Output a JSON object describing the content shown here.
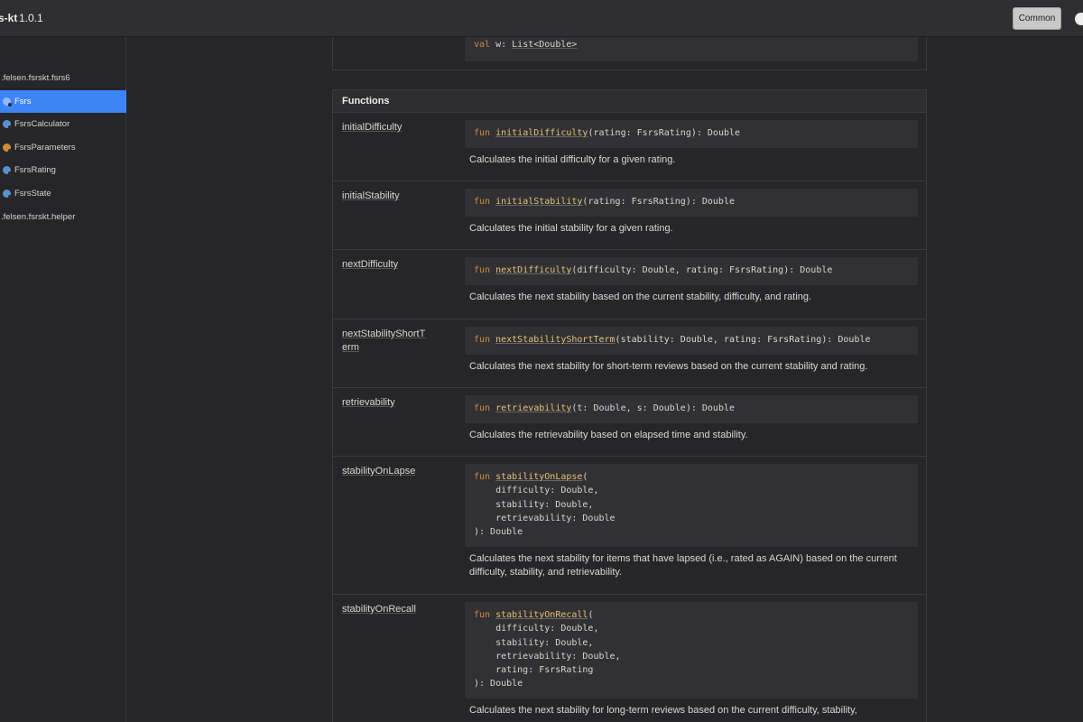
{
  "header": {
    "title": "s-kt",
    "version": "1.0.1",
    "common_label": "Common"
  },
  "sidebar": {
    "items": [
      {
        "label": ".felsen.fsrskt.fsrs6",
        "kind": "package"
      },
      {
        "label": "Fsrs",
        "kind": "class",
        "active": true
      },
      {
        "label": "FsrsCalculator",
        "kind": "class"
      },
      {
        "label": "FsrsParameters",
        "kind": "class"
      },
      {
        "label": "FsrsRating",
        "kind": "class"
      },
      {
        "label": "FsrsState",
        "kind": "class"
      },
      {
        "label": ".felsen.fsrskt.helper",
        "kind": "package"
      }
    ]
  },
  "property": {
    "name": "w",
    "kw": "val",
    "sig_rest": " w: ",
    "type": "List<Double>"
  },
  "functions": {
    "header": "Functions",
    "items": [
      {
        "name": "initialDifficulty",
        "kw": "fun",
        "fn": "initialDifficulty",
        "params": "(rating: FsrsRating): Double",
        "desc": "Calculates the initial difficulty for a given rating."
      },
      {
        "name": "initialStability",
        "kw": "fun",
        "fn": "initialStability",
        "params": "(rating: FsrsRating): Double",
        "desc": "Calculates the initial stability for a given rating."
      },
      {
        "name": "nextDifficulty",
        "kw": "fun",
        "fn": "nextDifficulty",
        "params": "(difficulty: Double, rating: FsrsRating): Double",
        "desc": "Calculates the next stability based on the current stability, difficulty, and rating."
      },
      {
        "name": "nextStabilityShortTerm",
        "kw": "fun",
        "fn": "nextStabilityShortTerm",
        "params": "(stability: Double, rating: FsrsRating): Double",
        "desc": "Calculates the next stability for short-term reviews based on the current stability and rating."
      },
      {
        "name": "retrievability",
        "kw": "fun",
        "fn": "retrievability",
        "params": "(t: Double, s: Double): Double",
        "desc": "Calculates the retrievability based on elapsed time and stability."
      },
      {
        "name": "stabilityOnLapse",
        "kw": "fun",
        "fn": "stabilityOnLapse",
        "params": "(\n    difficulty: Double,\n    stability: Double,\n    retrievability: Double\n): Double",
        "desc": "Calculates the next stability for items that have lapsed (i.e., rated as AGAIN) based on the current difficulty, stability, and retrievability."
      },
      {
        "name": "stabilityOnRecall",
        "kw": "fun",
        "fn": "stabilityOnRecall",
        "params": "(\n    difficulty: Double,\n    stability: Double,\n    retrievability: Double,\n    rating: FsrsRating\n): Double",
        "desc": "Calculates the next stability for long-term reviews based on the current difficulty, stability,"
      }
    ]
  }
}
